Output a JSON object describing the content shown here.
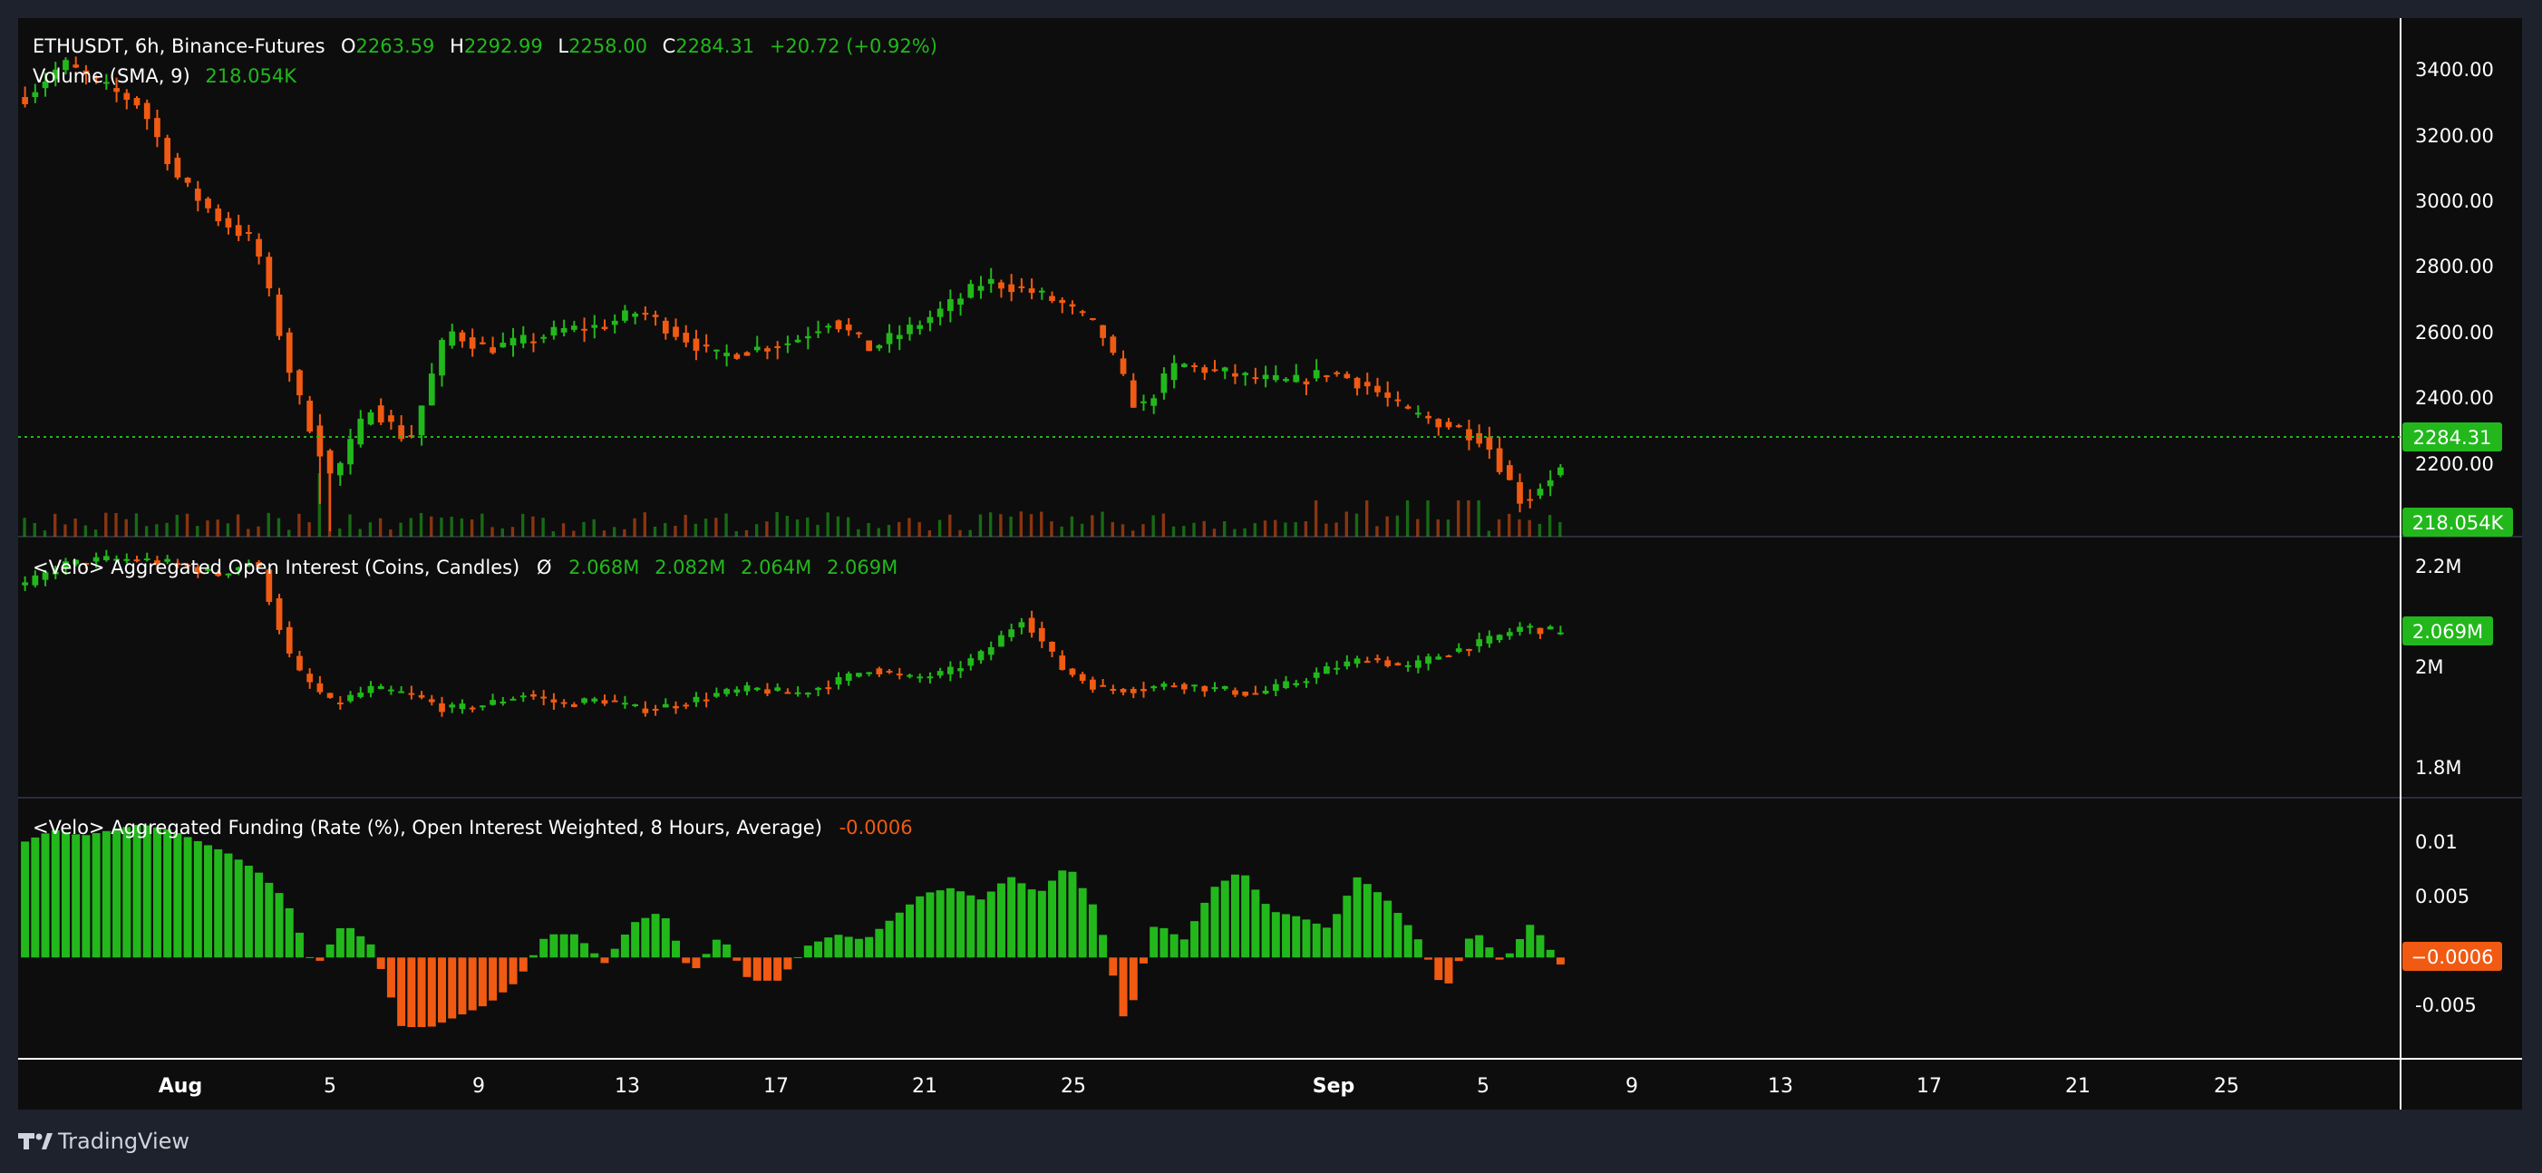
{
  "header": {
    "symbol": "ETHUSDT, 6h, Binance-Futures",
    "o_label": "O",
    "o_value": "2263.59",
    "h_label": "H",
    "h_value": "2292.99",
    "l_label": "L",
    "l_value": "2258.00",
    "c_label": "C",
    "c_value": "2284.31",
    "change": "+20.72 (+0.92%)",
    "volume_label": "Volume (SMA, 9)",
    "volume_value": "218.054K"
  },
  "price_axis": {
    "ticks": [
      "3400.00",
      "3200.00",
      "3000.00",
      "2800.00",
      "2600.00",
      "2400.00",
      "2200.00"
    ],
    "last_price": "2284.31",
    "last_volume": "218.054K"
  },
  "oi_pane": {
    "title": "<Velo> Aggregated Open Interest (Coins, Candles)",
    "symbol": "Ø",
    "values": [
      "2.068M",
      "2.082M",
      "2.064M",
      "2.069M"
    ],
    "ticks": [
      "2.2M",
      "2M",
      "1.8M"
    ],
    "last": "2.069M"
  },
  "funding_pane": {
    "title": "<Velo> Aggregated Funding (Rate (%), Open Interest Weighted, 8 Hours, Average)",
    "value": "-0.0006",
    "ticks": [
      "0.01",
      "0.005",
      "-0.005"
    ],
    "last": "−0.0006"
  },
  "time_axis": {
    "labels": [
      "Aug",
      "5",
      "9",
      "13",
      "17",
      "21",
      "25",
      "Sep",
      "5",
      "9",
      "13",
      "17",
      "21",
      "25"
    ]
  },
  "footer": {
    "brand": "TradingView"
  },
  "colors": {
    "up": "#22b81c",
    "down": "#f05a13",
    "background": "#0d0d0d",
    "frame": "#1e222d",
    "text": "#d1d4dc",
    "grid_line": "#2a2e39"
  },
  "chart_data": [
    {
      "type": "candlestick",
      "title": "ETHUSDT, 6h, Binance-Futures",
      "ylim": [
        2100,
        3480
      ],
      "interval": "6h",
      "close_path": [
        3270,
        3360,
        3300,
        3250,
        3050,
        2950,
        2880,
        2500,
        2250,
        2450,
        2350,
        2650,
        2600,
        2620,
        2650,
        2660,
        2700,
        2640,
        2580,
        2600,
        2620,
        2680,
        2600,
        2650,
        2710,
        2780,
        2760,
        2720,
        2650,
        2430,
        2560,
        2540,
        2520,
        2510,
        2540,
        2500,
        2430,
        2400,
        2360,
        2190,
        2284.31
      ],
      "last": {
        "open": 2263.59,
        "high": 2292.99,
        "low": 2258.0,
        "close": 2284.31
      }
    },
    {
      "type": "bar",
      "title": "Volume (SMA, 9)",
      "last": 218054
    },
    {
      "type": "candlestick",
      "title": "<Velo> Aggregated Open Interest (Coins, Candles)",
      "ylim": [
        1.75,
        2.24
      ],
      "units": "M",
      "close_path": [
        2.16,
        2.2,
        2.21,
        2.21,
        2.2,
        2.18,
        2.21,
        2.0,
        1.93,
        1.96,
        1.95,
        1.92,
        1.93,
        1.95,
        1.93,
        1.94,
        1.92,
        1.93,
        1.95,
        1.96,
        1.95,
        1.97,
        2.0,
        1.98,
        1.99,
        2.03,
        2.1,
        2.0,
        1.96,
        1.96,
        1.97,
        1.96,
        1.95,
        1.97,
        2.0,
        2.02,
        2.0,
        2.03,
        2.05,
        2.08,
        2.069
      ],
      "last": {
        "open": 2.068,
        "high": 2.082,
        "low": 2.064,
        "close": 2.069
      }
    },
    {
      "type": "bar",
      "title": "<Velo> Aggregated Funding (Rate (%), Open Interest Weighted, 8 Hours, Average)",
      "ylim": [
        -0.0085,
        0.013
      ],
      "values": [
        0.01,
        0.011,
        0.0105,
        0.011,
        0.0115,
        0.011,
        0.01,
        0.009,
        0.0075,
        0.005,
        -0.001,
        0.003,
        0.001,
        -0.006,
        -0.006,
        -0.005,
        -0.004,
        -0.002,
        0.002,
        0.002,
        -0.0005,
        0.003,
        0.004,
        -0.0015,
        0.002,
        -0.002,
        -0.002,
        0.001,
        0.002,
        0.0015,
        0.0035,
        0.0055,
        0.006,
        0.005,
        0.007,
        0.0055,
        0.008,
        0.004,
        -0.006,
        0.003,
        0.0015,
        0.006,
        0.0075,
        0.004,
        0.0035,
        0.0025,
        0.007,
        0.005,
        0.002,
        -0.003,
        0.0025,
        -0.0005,
        0.003,
        -0.0006
      ],
      "last": -0.0006
    }
  ]
}
